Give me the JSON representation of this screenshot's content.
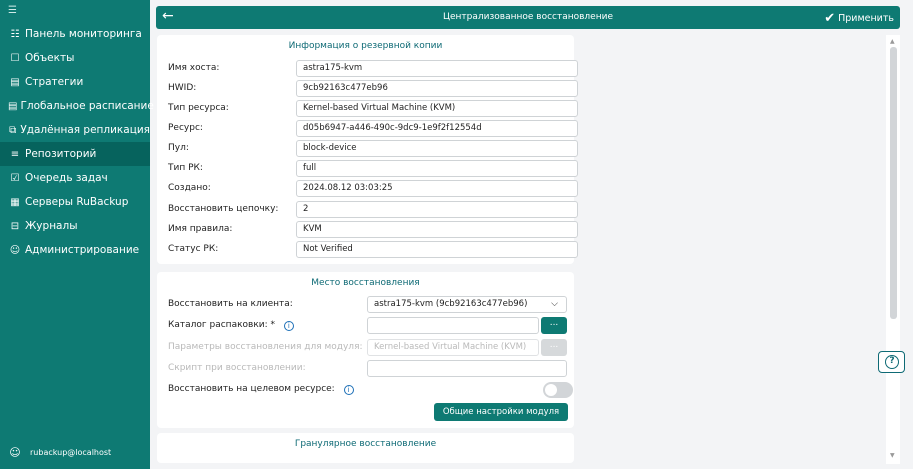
{
  "sidebar": {
    "collapse_glyph": "☰",
    "items": [
      {
        "label": "Панель мониторинга",
        "icon": "dashboard-icon",
        "glyph": "☷"
      },
      {
        "label": "Объекты",
        "icon": "monitor-icon",
        "glyph": "☐"
      },
      {
        "label": "Стратегии",
        "icon": "document-icon",
        "glyph": "▤"
      },
      {
        "label": "Глобальное расписание",
        "icon": "schedule-icon",
        "glyph": "▤"
      },
      {
        "label": "Удалённая репликация",
        "icon": "replication-icon",
        "glyph": "⧉"
      },
      {
        "label": "Репозиторий",
        "icon": "database-icon",
        "glyph": "≡",
        "active": true
      },
      {
        "label": "Очередь задач",
        "icon": "task-queue-icon",
        "glyph": "☑"
      },
      {
        "label": "Серверы RuBackup",
        "icon": "server-icon",
        "glyph": "▦"
      },
      {
        "label": "Журналы",
        "icon": "log-icon",
        "glyph": "⊟"
      },
      {
        "label": "Администрирование",
        "icon": "users-icon",
        "glyph": "☺"
      }
    ],
    "user": {
      "label": "rubackup@localhost",
      "icon": "user-icon",
      "glyph": "☺"
    }
  },
  "header": {
    "title": "Централизованное восстановление",
    "back_glyph": "←",
    "apply_label": "Применить",
    "apply_glyph": "✔"
  },
  "backup_info": {
    "title": "Информация о резервной копии",
    "fields": [
      {
        "label": "Имя хоста:",
        "value": "astra175-kvm"
      },
      {
        "label": "HWID:",
        "value": "9cb92163c477eb96"
      },
      {
        "label": "Тип ресурса:",
        "value": "Kernel-based Virtual Machine (KVM)"
      },
      {
        "label": "Ресурс:",
        "value": "d05b6947-a446-490c-9dc9-1e9f2f12554d"
      },
      {
        "label": "Пул:",
        "value": "block-device"
      },
      {
        "label": "Тип РК:",
        "value": "full"
      },
      {
        "label": "Создано:",
        "value": "2024.08.12 03:03:25"
      },
      {
        "label": "Восстановить цепочку:",
        "value": "2"
      },
      {
        "label": "Имя правила:",
        "value": "KVM"
      },
      {
        "label": "Статус РК:",
        "value": "Not Verified"
      }
    ]
  },
  "restore_location": {
    "title": "Место восстановления",
    "client_label": "Восстановить на клиента:",
    "client_value": "astra175-kvm (9cb92163c477eb96)",
    "client_arrow": "⌵",
    "unpack_label": "Каталог распаковки:",
    "required_mark": "*",
    "unpack_value": "",
    "dots_label": "...",
    "module_params_label": "Параметры восстановления для модуля:",
    "module_params_value": "Kernel-based Virtual Machine (KVM)",
    "script_label": "Скрипт при восстановлении:",
    "script_value": "",
    "target_label": "Восстановить на целевом ресурсе:",
    "target_enabled": false,
    "info_glyph": "i",
    "module_settings_button": "Общие настройки модуля"
  },
  "granular": {
    "title": "Гранулярное восстановление"
  },
  "scrollbar": {
    "up": "▲",
    "down": "▼"
  },
  "help": {
    "glyph": "?"
  },
  "colors": {
    "accent": "#0e7a73",
    "accent_dark": "#06635d",
    "title_text": "#0e6a75",
    "info_blue": "#1c6fb7"
  }
}
